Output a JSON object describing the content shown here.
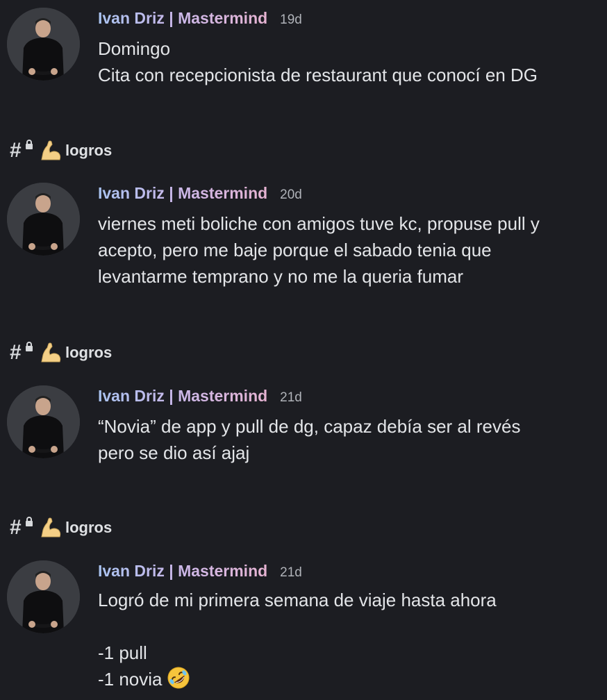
{
  "messages": [
    {
      "author": "Ivan Driz | Mastermind",
      "time": "19d",
      "lines": [
        "Domingo",
        "Cita con recepcionista de restaurant que conocí en DG"
      ]
    },
    {
      "channel": "logros",
      "author": "Ivan Driz | Mastermind",
      "time": "20d",
      "lines": [
        "viernes meti boliche con amigos tuve kc, propuse pull y",
        "acepto, pero me baje porque el sabado tenia que",
        "levantarme temprano y no me la queria fumar"
      ]
    },
    {
      "channel": "logros",
      "author": "Ivan Driz | Mastermind",
      "time": "21d",
      "lines": [
        "“Novia” de app y pull de dg, capaz debía ser al revés",
        "pero se dio así ajaj"
      ]
    },
    {
      "channel": "logros",
      "author": "Ivan Driz | Mastermind",
      "time": "21d",
      "lines": [
        "Logró de mi primera semana de viaje hasta ahora",
        "",
        "-1 pull",
        "-1 novia"
      ]
    }
  ],
  "icons": {
    "channel_icon": "hash-lock-icon",
    "channel_emoji": "flexed-biceps-icon",
    "reaction_emoji": "rolling-on-floor-laughing-icon"
  },
  "colors": {
    "background": "#1c1d22",
    "text": "#e3e5e8",
    "timestamp": "#b0b3b9",
    "author_gradient_start": "#a9c3f0",
    "author_gradient_end": "#e6b3d2"
  }
}
